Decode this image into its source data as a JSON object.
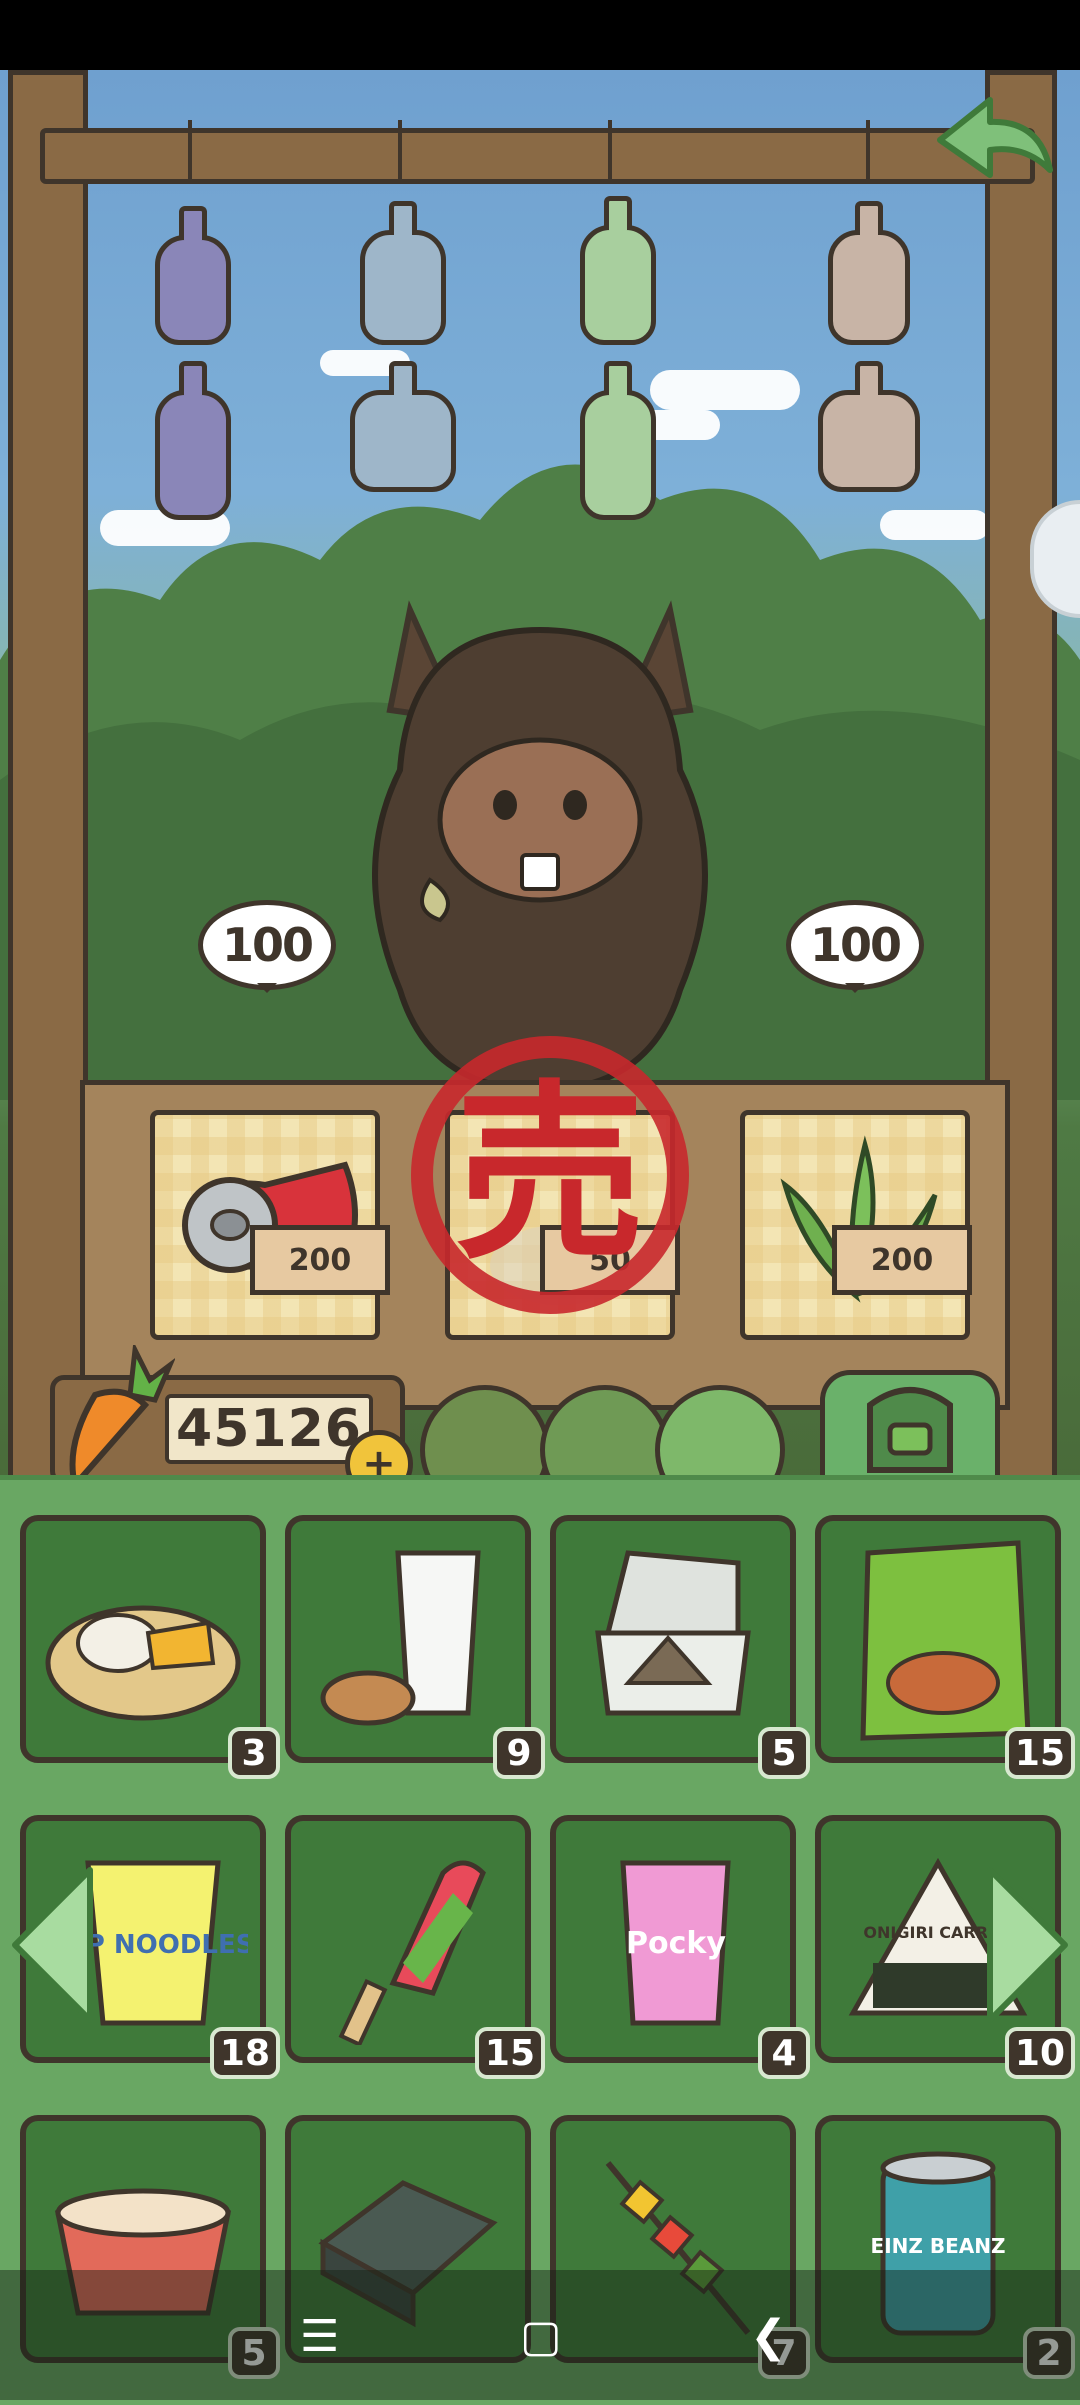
{
  "currency": {
    "amount": "45126",
    "plus_label": "+"
  },
  "counter": {
    "bubbles": [
      {
        "value": "100"
      },
      {
        "value": "100"
      }
    ],
    "slots": [
      {
        "item": "crushed-can-icon",
        "price": "200"
      },
      {
        "item": "sold-item-icon",
        "price": "50"
      },
      {
        "item": "seaweed-icon",
        "price": "200"
      }
    ],
    "stamp_char": "売"
  },
  "inventory": {
    "items": [
      {
        "name": "mango-rice-icon",
        "count": "3"
      },
      {
        "name": "milk-cookies-icon",
        "count": "9"
      },
      {
        "name": "sandwich-box-icon",
        "count": "5"
      },
      {
        "name": "snack-bag-icon",
        "count": "15"
      },
      {
        "name": "cup-noodles-icon",
        "count": "18"
      },
      {
        "name": "popsicle-icon",
        "count": "15"
      },
      {
        "name": "pocky-icon",
        "count": "4"
      },
      {
        "name": "onigiri-icon",
        "count": "10"
      },
      {
        "name": "instant-ramen-bowl-icon",
        "count": "5"
      },
      {
        "name": "sushi-box-icon",
        "count": ""
      },
      {
        "name": "kebab-skewer-icon",
        "count": "7"
      },
      {
        "name": "beans-can-icon",
        "count": "2"
      }
    ],
    "labels": {
      "cup_noodles": "CUP NOODLES",
      "pocky": "Pocky",
      "onigiri": "ONIGIRI CARROT",
      "beans": "EINZ BEANZ"
    }
  },
  "nav": {
    "menu": "☰",
    "home": "▢",
    "back": "❮"
  }
}
